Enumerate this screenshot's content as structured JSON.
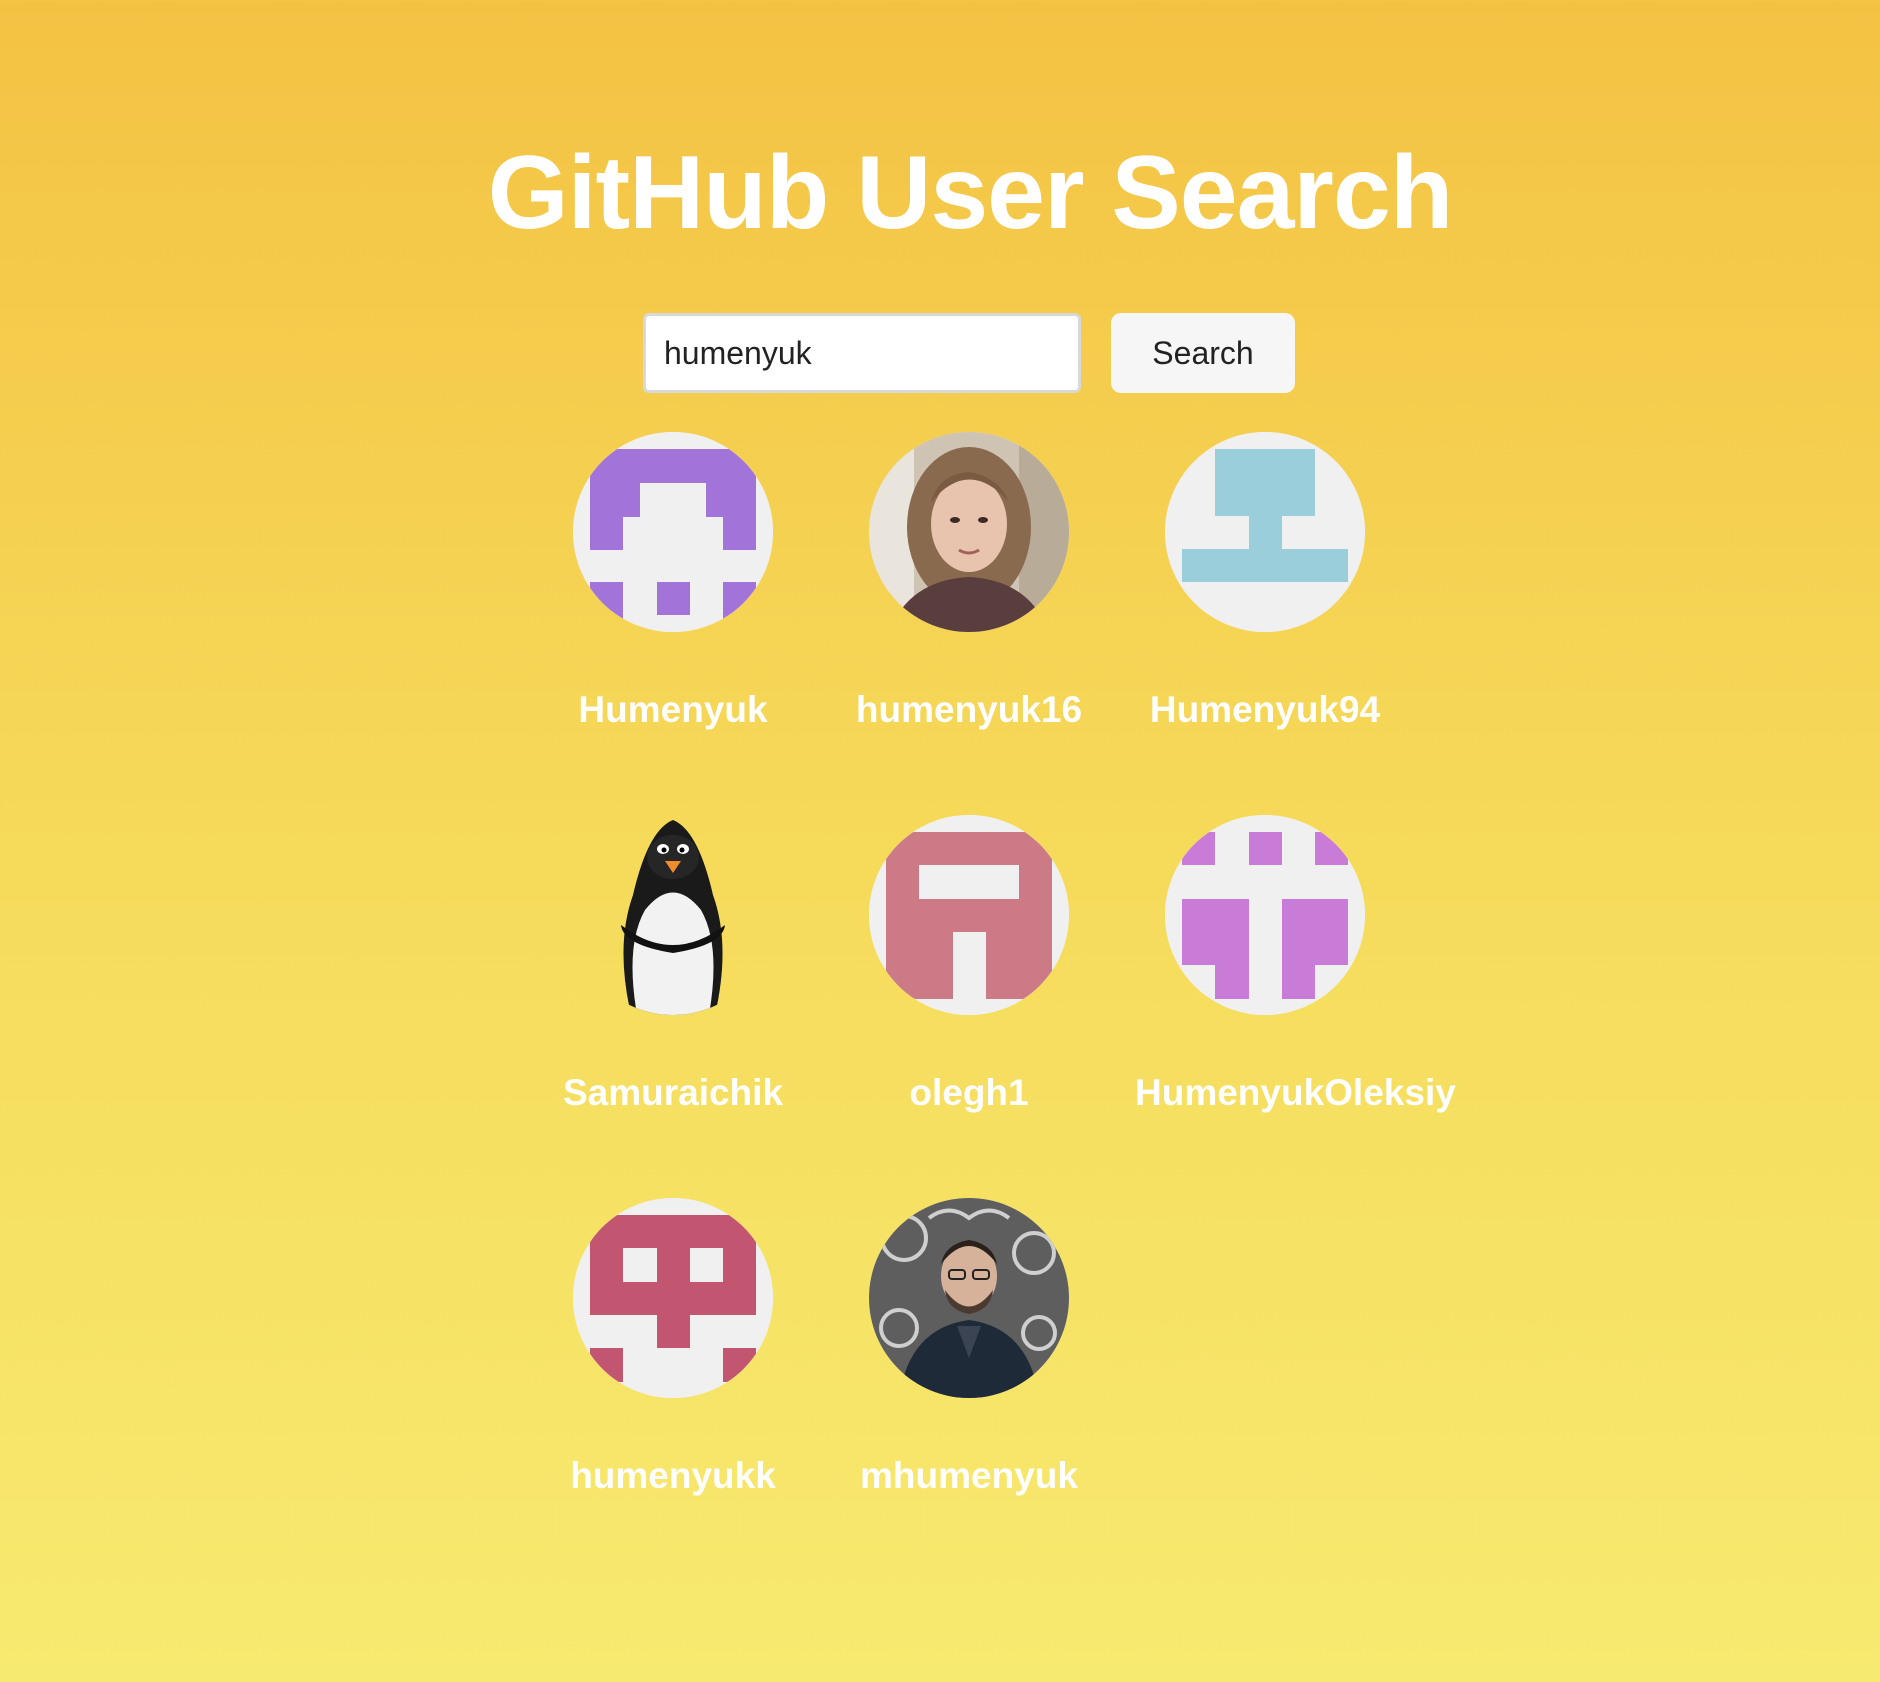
{
  "title": "GitHub User Search",
  "search": {
    "value": "humenyuk",
    "button_label": "Search"
  },
  "users": [
    {
      "username": "Humenyuk",
      "avatar": "identicon-purple"
    },
    {
      "username": "humenyuk16",
      "avatar": "photo-woman"
    },
    {
      "username": "Humenyuk94",
      "avatar": "identicon-light-blue"
    },
    {
      "username": "Samuraichik",
      "avatar": "penguin"
    },
    {
      "username": "olegh1",
      "avatar": "identicon-dusty-pink"
    },
    {
      "username": "HumenyukOleksiy",
      "avatar": "identicon-orchid"
    },
    {
      "username": "humenyukk",
      "avatar": "identicon-crimson"
    },
    {
      "username": "mhumenyuk",
      "avatar": "photo-man"
    }
  ],
  "colors": {
    "background_top": "#f4c243",
    "background_bottom": "#f7ea70",
    "identicon_purple": "#a273d9",
    "identicon_light_blue": "#9bcedb",
    "identicon_dusty_pink": "#cc7b86",
    "identicon_orchid": "#c87bd7",
    "identicon_crimson": "#c25670"
  }
}
